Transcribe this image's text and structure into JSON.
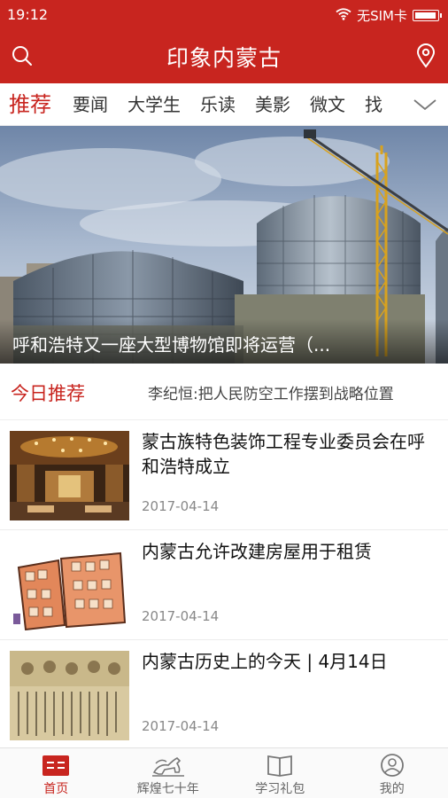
{
  "status_bar": {
    "time": "19:12",
    "carrier": "无SIM卡",
    "icons": [
      "wifi-icon",
      "battery-icon"
    ]
  },
  "app_bar": {
    "title": "印象内蒙古",
    "left_icon": "search-icon",
    "right_icon": "location-pin-icon"
  },
  "tabs": {
    "items": [
      {
        "label": "推荐",
        "active": true
      },
      {
        "label": "要闻"
      },
      {
        "label": "大学生"
      },
      {
        "label": "乐读"
      },
      {
        "label": "美影"
      },
      {
        "label": "微文"
      },
      {
        "label": "找"
      }
    ],
    "more_icon": "chevron-down-icon"
  },
  "banner": {
    "caption": "呼和浩特又一座大型博物馆即将运营（..."
  },
  "today": {
    "label": "今日推荐",
    "headline": "李纪恒:把人民防空工作摆到战略位置"
  },
  "news": [
    {
      "title": "蒙古族特色装饰工程专业委员会在呼和浩特成立",
      "date": "2017-04-14"
    },
    {
      "title": "内蒙古允许改建房屋用于租赁",
      "date": "2017-04-14"
    },
    {
      "title": "内蒙古历史上的今天 | 4月14日",
      "date": "2017-04-14"
    }
  ],
  "bottom_nav": [
    {
      "label": "首页",
      "icon": "home-icon",
      "active": true
    },
    {
      "label": "辉煌七十年",
      "icon": "horse-icon"
    },
    {
      "label": "学习礼包",
      "icon": "book-icon"
    },
    {
      "label": "我的",
      "icon": "user-icon"
    }
  ],
  "colors": {
    "brand_red": "#c8251f",
    "text_dark": "#111111",
    "text_muted": "#888888"
  }
}
